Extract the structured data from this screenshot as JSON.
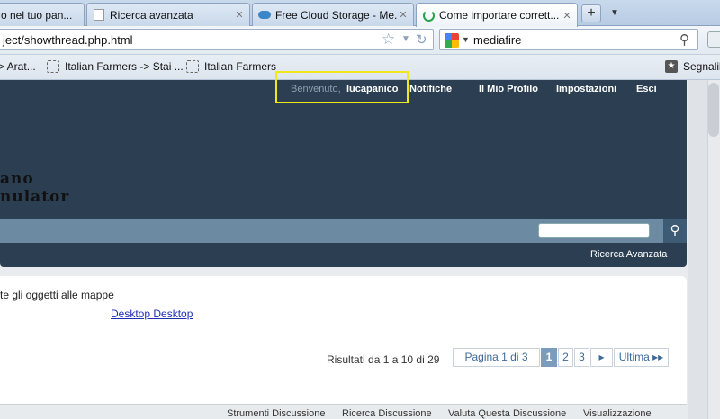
{
  "tabs": [
    {
      "title": "o nel tuo pan..."
    },
    {
      "title": "Ricerca avanzata"
    },
    {
      "title": "Free Cloud Storage - Me..."
    },
    {
      "title": "Come importare corrett..."
    }
  ],
  "urlbar": {
    "text": "ject/showthread.php.html"
  },
  "searchbar": {
    "value": "mediafire"
  },
  "bookmarks": [
    {
      "label": "> Arat..."
    },
    {
      "label": "Italian Farmers -> Stai ..."
    },
    {
      "label": "Italian Farmers"
    }
  ],
  "bookmarks_right": "Segnalib",
  "header": {
    "welcome": "Benvenuto,",
    "username": "lucapanico",
    "nav": [
      "Notifiche",
      "Il Mio Profilo",
      "Impostazioni",
      "Esci"
    ],
    "logo_line1": "ano",
    "logo_line2": "nulator"
  },
  "subnav": {
    "advanced_search": "Ricerca Avanzata"
  },
  "thread": {
    "title": "te gli oggetti alle mappe",
    "link": "Desktop Desktop",
    "results": "Risultati da 1 a 10 di 29"
  },
  "pager": {
    "label": "Pagina 1 di 3",
    "pages": [
      "1",
      "2",
      "3"
    ],
    "next": "▸",
    "last": "Ultima ▸▸"
  },
  "tools": [
    "Strumenti Discussione",
    "Ricerca Discussione",
    "Valuta Questa Discussione",
    "Visualizzazione"
  ],
  "colors": {
    "header": "#2c3f52",
    "subnav": "#6c8ba3",
    "highlight": "#f0e81a",
    "link": "#1f2db8"
  }
}
